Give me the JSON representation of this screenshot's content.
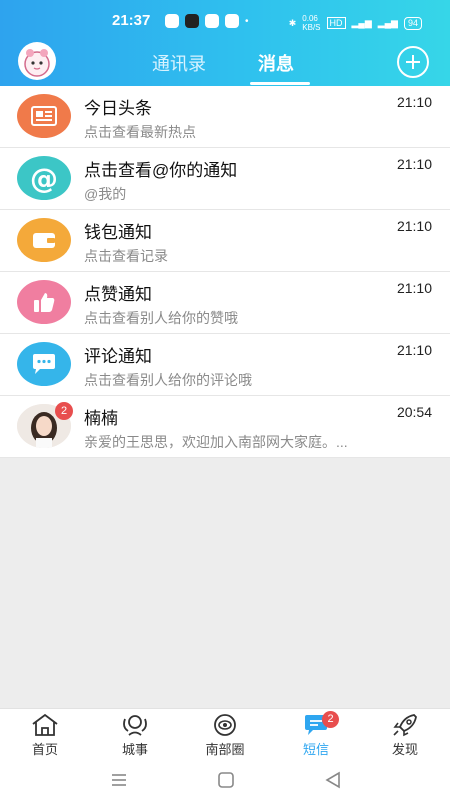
{
  "status_bar": {
    "time": "21:37",
    "speed": "0.06\nKB/S",
    "battery": "94"
  },
  "header": {
    "tab_contacts": "通讯录",
    "tab_messages": "消息"
  },
  "messages": [
    {
      "title": "今日头条",
      "subtitle": "点击查看最新热点",
      "time": "21:10",
      "icon": "newspaper-icon",
      "color": "#f07a4a"
    },
    {
      "title": "点击查看@你的通知",
      "subtitle": "@我的",
      "time": "21:10",
      "icon": "at-icon",
      "color": "#3cc6c6"
    },
    {
      "title": "钱包通知",
      "subtitle": "点击查看记录",
      "time": "21:10",
      "icon": "wallet-icon",
      "color": "#f4a93a"
    },
    {
      "title": "点赞通知",
      "subtitle": "点击查看别人给你的赞哦",
      "time": "21:10",
      "icon": "thumbs-up-icon",
      "color": "#f07ea0"
    },
    {
      "title": "评论通知",
      "subtitle": "点击查看别人给你的评论哦",
      "time": "21:10",
      "icon": "comment-icon",
      "color": "#35b5ea"
    },
    {
      "title": "楠楠",
      "subtitle": "亲爱的王思思，欢迎加入南部网大家庭。...",
      "time": "20:54",
      "icon": "user-avatar",
      "badge": "2"
    }
  ],
  "tabbar": [
    {
      "label": "首页",
      "icon": "home-icon"
    },
    {
      "label": "城事",
      "icon": "city-icon"
    },
    {
      "label": "南部圈",
      "icon": "circle-icon"
    },
    {
      "label": "短信",
      "icon": "message-icon",
      "badge": "2",
      "active": true
    },
    {
      "label": "发现",
      "icon": "rocket-icon"
    }
  ],
  "colors": {
    "accent": "#2ea6f0",
    "badge": "#e84e4e"
  }
}
